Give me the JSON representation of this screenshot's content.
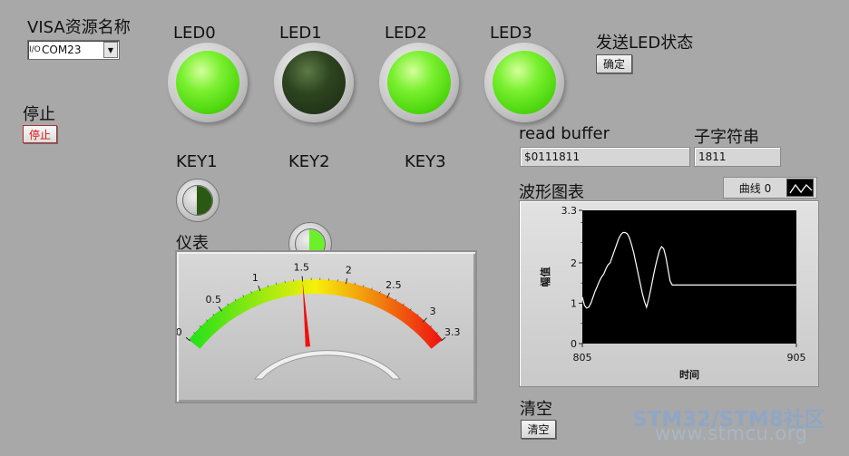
{
  "visa": {
    "label": "VISA资源名称",
    "icon": "io-icon",
    "icon_glyph": "I/O",
    "value": "COM23"
  },
  "stop": {
    "label": "停止",
    "button_label": "停止"
  },
  "leds": [
    {
      "label": "LED0",
      "state": "on"
    },
    {
      "label": "LED1",
      "state": "off"
    },
    {
      "label": "LED2",
      "state": "on"
    },
    {
      "label": "LED3",
      "state": "on"
    }
  ],
  "send_led": {
    "label": "发送LED状态",
    "button_label": "确定"
  },
  "keys": [
    {
      "label": "KEY1",
      "color": "#2a5a12"
    },
    {
      "label": "KEY2",
      "color": "#6cf02a"
    },
    {
      "label": "KEY3",
      "color": "#6cf02a"
    }
  ],
  "read_buffer": {
    "label": "read buffer",
    "value": "$0111811"
  },
  "substring": {
    "label": "子字符串",
    "value": "1811"
  },
  "meter": {
    "label": "仪表",
    "min": 0,
    "max": 3.3,
    "value": 1.5,
    "tick_labels": [
      "0",
      "0.5",
      "1",
      "1.5",
      "2",
      "2.5",
      "3",
      "3.3"
    ],
    "colors": {
      "low": "#22e01a",
      "mid": "#f6f00a",
      "high": "#ee1111",
      "needle": "#ee1111"
    }
  },
  "chart_data": {
    "type": "line",
    "title": "波形图表",
    "xlabel": "时间",
    "ylabel": "幅值",
    "xlim": [
      805,
      905
    ],
    "ylim": [
      0,
      3.3
    ],
    "x_ticks": [
      "805",
      "905"
    ],
    "y_ticks": [
      "0",
      "1",
      "2",
      "3.3"
    ],
    "legend": "曲线 0",
    "series": [
      {
        "name": "曲线 0",
        "color": "#ffffff",
        "x": [
          805,
          806,
          807,
          808,
          809,
          810,
          811,
          812,
          813,
          814,
          815,
          816,
          817,
          818,
          819,
          820,
          821,
          822,
          823,
          824,
          825,
          826,
          827,
          828,
          829,
          830,
          831,
          832,
          833,
          834,
          835,
          836,
          837,
          838,
          839,
          840,
          841,
          842,
          843,
          844,
          845,
          846,
          847,
          848,
          849,
          850,
          851,
          852,
          853,
          854,
          855,
          856,
          857,
          858,
          859,
          860,
          861,
          862,
          863,
          864,
          865,
          905
        ],
        "y": [
          1.15,
          0.95,
          0.88,
          0.9,
          1.0,
          1.15,
          1.3,
          1.42,
          1.55,
          1.65,
          1.72,
          1.85,
          1.95,
          2.0,
          2.15,
          2.3,
          2.45,
          2.6,
          2.7,
          2.75,
          2.75,
          2.72,
          2.62,
          2.45,
          2.25,
          2.0,
          1.75,
          1.5,
          1.25,
          1.05,
          0.9,
          1.1,
          1.35,
          1.62,
          1.88,
          2.1,
          2.3,
          2.4,
          2.35,
          2.15,
          1.85,
          1.55,
          1.45,
          1.45,
          1.45,
          1.45,
          1.45,
          1.45,
          1.45,
          1.45,
          1.45,
          1.45,
          1.45,
          1.45,
          1.45,
          1.45,
          1.45,
          1.45,
          1.45,
          1.45,
          1.45,
          1.45
        ]
      }
    ]
  },
  "clear": {
    "label": "清空",
    "button_label": "清空"
  },
  "watermark": {
    "brand": "STM32/STM8社区",
    "url": "www.stmcu.org"
  }
}
